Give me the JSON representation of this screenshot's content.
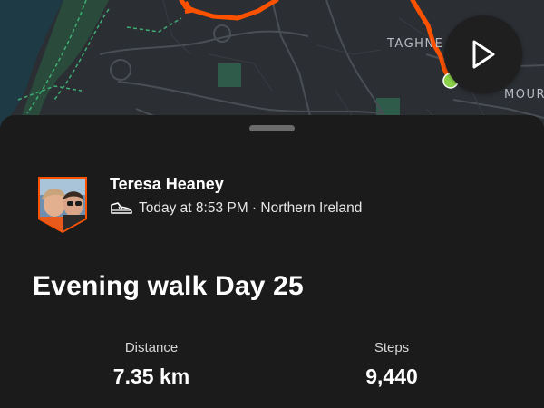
{
  "map": {
    "labels": [
      "TAGHNE",
      "MOUR"
    ],
    "colors": {
      "route": "#fc5200",
      "start_marker": "#8bd14a",
      "trail": "#3fae73",
      "water": "#1d3a45",
      "park": "#2f5b4a"
    }
  },
  "play_button": {
    "icon": "play-icon"
  },
  "athlete": {
    "name": "Teresa Heaney",
    "avatar_icon": "avatar-photo"
  },
  "activity": {
    "type_icon": "shoe-icon",
    "meta": "Today at 8:53 PM · Northern Ireland",
    "title": "Evening walk Day 25"
  },
  "stats": [
    {
      "label": "Distance",
      "value": "7.35 km"
    },
    {
      "label": "Steps",
      "value": "9,440"
    }
  ]
}
